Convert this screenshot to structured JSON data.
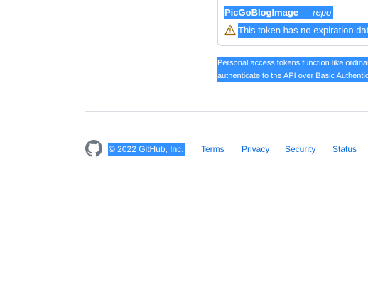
{
  "token": {
    "name": "PicGoBlogImage",
    "separator": " — ",
    "scope": "repo",
    "warning": "This token has no expiration date"
  },
  "note": {
    "line1": "Personal access tokens function like ordinary OAuth access tokens.",
    "line2": "authenticate to the API over Basic Authentication."
  },
  "footer": {
    "copyright": "© 2022 GitHub, Inc.",
    "links": [
      "Terms",
      "Privacy",
      "Security",
      "Status"
    ]
  },
  "colors": {
    "selection": "#3390ff",
    "link": "#0969da",
    "warning_icon": "#9a6700"
  },
  "icons": {
    "warning": "alert-triangle-icon",
    "logo": "github-mark-icon"
  }
}
